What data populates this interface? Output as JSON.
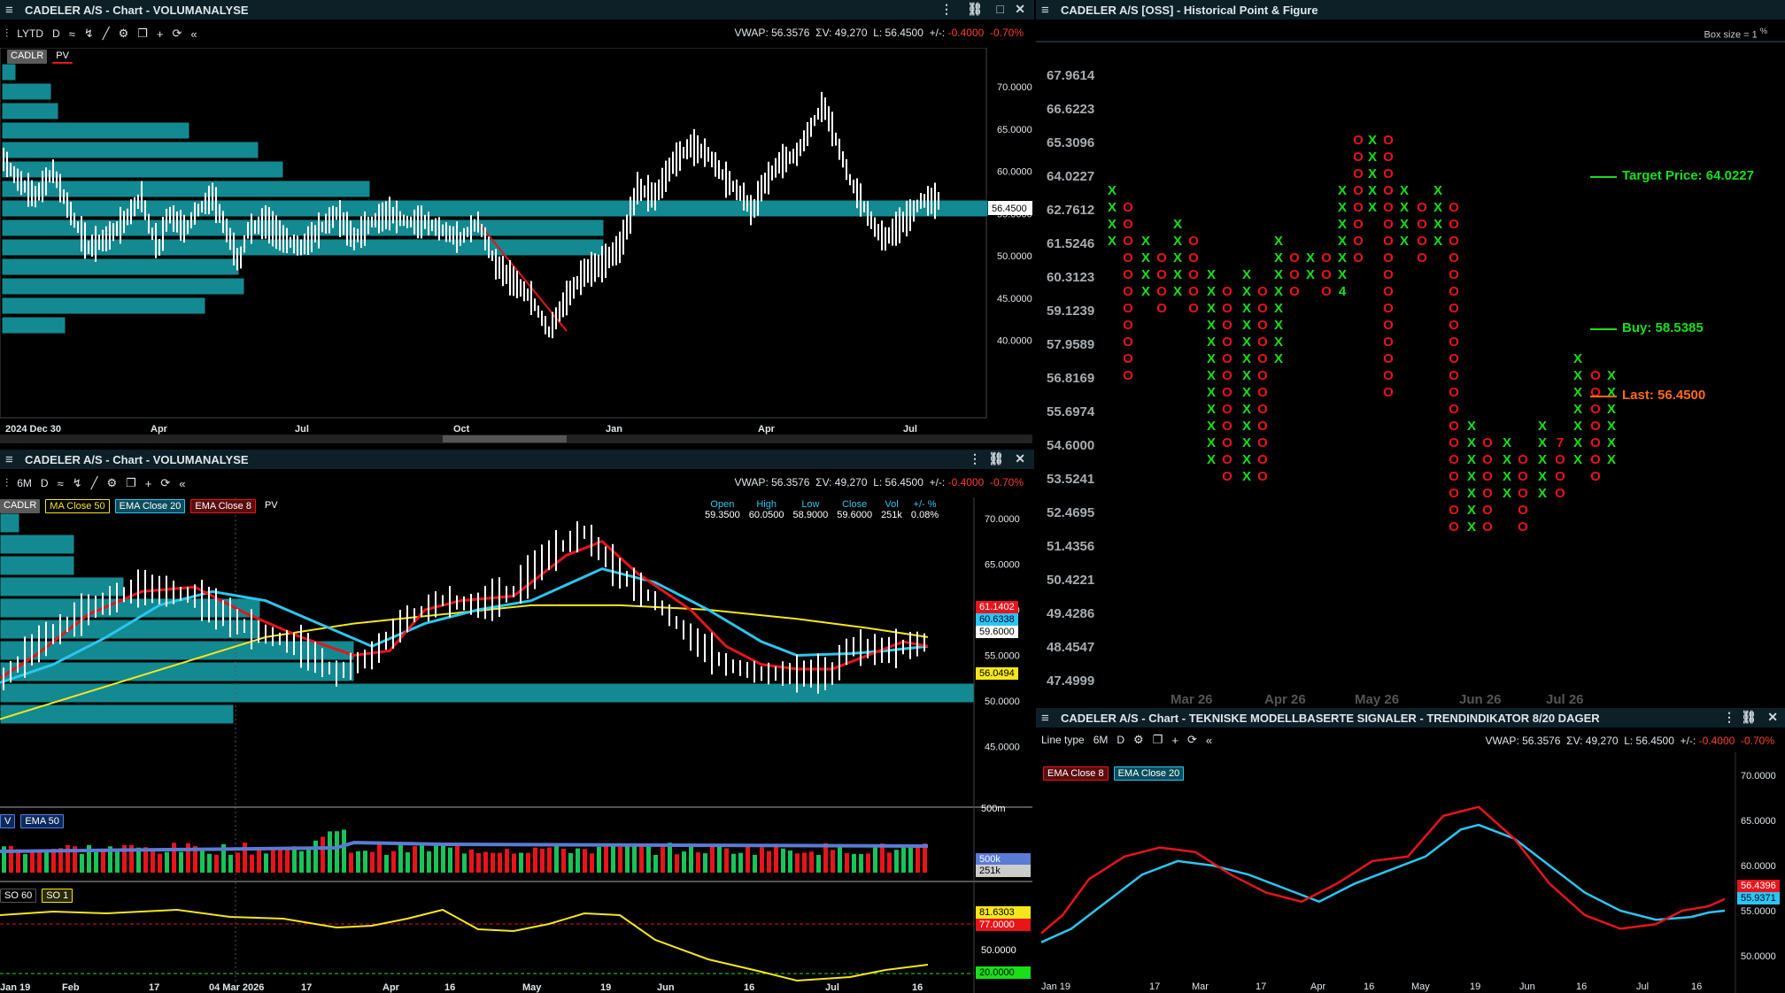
{
  "panel_tl": {
    "title": "CADELER A/S - Chart - VOLUMANALYSE",
    "toolbar": {
      "period": "LYTD",
      "interval": "D"
    },
    "stats": {
      "vwap": "VWAP: 56.3576",
      "sv": "ΣV: 49,270",
      "last": "L: 56.4500",
      "chg_label": "+/-:",
      "chg": "-0.4000",
      "pct": "-0.70%"
    },
    "legend": [
      "CADLR",
      "PV"
    ],
    "y_ticks": [
      "70.0000",
      "65.0000",
      "60.0000",
      "55.0000",
      "50.0000",
      "45.0000",
      "40.0000"
    ],
    "x_ticks": [
      "2024 Dec 30",
      "Apr",
      "Jul",
      "Oct",
      "Jan",
      "Apr",
      "Jul"
    ],
    "last_tag": "56.4500"
  },
  "panel_bl": {
    "title": "CADELER A/S - Chart - VOLUMANALYSE",
    "toolbar": {
      "period": "6M",
      "interval": "D"
    },
    "stats": {
      "vwap": "VWAP: 56.3576",
      "sv": "ΣV: 49,270",
      "last": "L: 56.4500",
      "chg_label": "+/-:",
      "chg": "-0.4000",
      "pct": "-0.70%"
    },
    "legend": [
      "CADLR",
      "MA  Close 50",
      "EMA  Close 20",
      "EMA  Close 8",
      "PV"
    ],
    "ohlc": {
      "headers": [
        "Open",
        "High",
        "Low",
        "Close",
        "Vol",
        "+/- %"
      ],
      "values": [
        "59.3500",
        "60.0500",
        "58.9000",
        "59.6000",
        "251k",
        "0.08%"
      ]
    },
    "y_ticks": [
      "70.0000",
      "65.0000",
      "60.0000",
      "55.0000",
      "50.0000",
      "45.0000"
    ],
    "tags": {
      "ema8": "61.1402",
      "ema20": "60.6338",
      "close": "59.6000",
      "ma50": "56.0494"
    },
    "vol_legend": [
      "V",
      "EMA  50"
    ],
    "vol_ticks": {
      "top": "500m",
      "mid": "500k",
      "low": "251k"
    },
    "so_legend": [
      "SO  60",
      "SO  1"
    ],
    "so_ticks": {
      "val": "81.6303",
      "upper": "77.0000",
      "mid": "50.0000",
      "lower": "20.0000"
    },
    "x_ticks": [
      "Jan 19",
      "Feb",
      "17",
      "04 Mar 2026",
      "17",
      "Apr",
      "16",
      "May",
      "19",
      "Jun",
      "16",
      "Jul",
      "16"
    ]
  },
  "panel_tr": {
    "title": "CADELER A/S [OSS] - Historical Point & Figure",
    "box_size": "Box size = 1",
    "box_size_unit": "%",
    "y_ticks": [
      "67.9614",
      "66.6223",
      "65.3096",
      "64.0227",
      "62.7612",
      "61.5246",
      "60.3123",
      "59.1239",
      "57.9589",
      "56.8169",
      "55.6974",
      "54.6000",
      "53.5241",
      "52.4695",
      "51.4356",
      "50.4221",
      "49.4286",
      "48.4547",
      "47.4999"
    ],
    "x_ticks": [
      "Mar 26",
      "Apr 26",
      "May 26",
      "Jun 26",
      "Jul 26"
    ],
    "target": "Target Price: 64.0227",
    "buy": "Buy: 58.5385",
    "last": "Last: 56.4500",
    "col_marker": "4",
    "col_marker2": "7"
  },
  "panel_br": {
    "title": "CADELER A/S - Chart - TEKNISKE MODELLBASERTE SIGNALER - TRENDINDIKATOR 8/20 DAGER",
    "toolbar": {
      "linetype": "Line type",
      "period": "6M",
      "interval": "D"
    },
    "stats": {
      "vwap": "VWAP: 56.3576",
      "sv": "ΣV: 49,270",
      "last": "L: 56.4500",
      "chg_label": "+/-:",
      "chg": "-0.4000",
      "pct": "-0.70%"
    },
    "legend": [
      "EMA  Close 8",
      "EMA  Close 20"
    ],
    "y_ticks": [
      "70.0000",
      "65.0000",
      "60.0000",
      "55.0000",
      "50.0000"
    ],
    "tags": {
      "ema8": "56.4396",
      "ema20": "55.9371"
    },
    "x_ticks": [
      "Jan 19",
      "17",
      "Mar",
      "17",
      "Apr",
      "16",
      "May",
      "19",
      "Jun",
      "16",
      "Jul",
      "16"
    ]
  },
  "colors": {
    "teal": "#138a91",
    "red": "#e8141b",
    "cyan": "#2bc6f0",
    "yellow": "#f5e61b",
    "green": "#17e017",
    "orange": "#ff6a1a",
    "pf_x": "#17e017",
    "pf_o": "#e8141b"
  }
}
